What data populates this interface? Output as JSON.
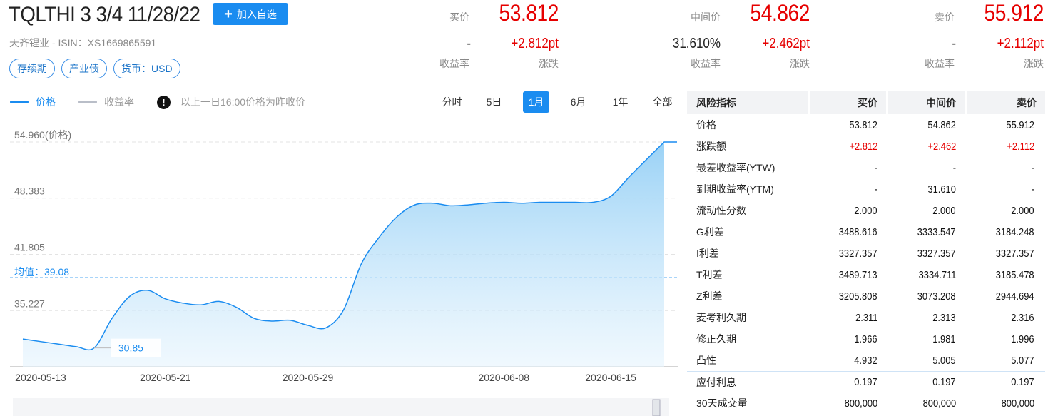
{
  "header": {
    "title": "TQLTHI 3 3/4 11/28/22",
    "watch_label": "加入自选",
    "subtitle": "天齐锂业 - ISIN：XS1669865591",
    "tags": [
      "存续期",
      "产业债",
      "货币：USD"
    ]
  },
  "quotes": {
    "bid": {
      "label": "买价",
      "price": "53.812",
      "yield": "-",
      "yield_label": "收益率",
      "change": "+2.812pt",
      "change_label": "涨跌"
    },
    "mid": {
      "label": "中间价",
      "price": "54.862",
      "yield": "31.610%",
      "yield_label": "收益率",
      "change": "+2.462pt",
      "change_label": "涨跌"
    },
    "ask": {
      "label": "卖价",
      "price": "55.912",
      "yield": "-",
      "yield_label": "收益率",
      "change": "+2.112pt",
      "change_label": "涨跌"
    }
  },
  "chart_controls": {
    "legend": [
      {
        "label": "价格",
        "color": "#1a8cf0",
        "active": true
      },
      {
        "label": "收益率",
        "color": "#b9bec8",
        "active": false
      }
    ],
    "note": "以上一日16:00价格为昨收价",
    "periods": [
      "分时",
      "5日",
      "1月",
      "6月",
      "1年",
      "全部"
    ],
    "active_period": "1月"
  },
  "chart_data": {
    "type": "area",
    "series": [
      {
        "name": "价格",
        "color": "#1a8cf0",
        "x": [
          0,
          1,
          2,
          3,
          4,
          5,
          6,
          7,
          8,
          9,
          10,
          11,
          12,
          13,
          14,
          15,
          16,
          17,
          18,
          19,
          20,
          21,
          22,
          23,
          24,
          25,
          26,
          27,
          28,
          29,
          30,
          31,
          32,
          33,
          34,
          35,
          36
        ],
        "values": [
          31.9,
          31.6,
          31.3,
          31.0,
          30.85,
          34.3,
          36.9,
          37.6,
          36.6,
          36.1,
          35.9,
          36.3,
          35.6,
          34.3,
          34.0,
          34.1,
          33.5,
          33.2,
          35.3,
          40.7,
          43.8,
          46.2,
          47.6,
          47.8,
          47.5,
          47.6,
          47.8,
          47.9,
          47.8,
          47.9,
          47.9,
          47.9,
          47.9,
          48.6,
          50.8,
          52.9,
          54.96
        ]
      }
    ],
    "x_tick_labels": [
      "2020-05-13",
      "2020-05-21",
      "2020-05-29",
      "2020-06-08",
      "2020-06-15"
    ],
    "x_tick_positions": [
      1,
      8,
      16,
      27,
      33
    ],
    "y_tick_labels": [
      "54.960(价格)",
      "48.383",
      "41.805",
      "35.227"
    ],
    "y_ticks": [
      54.96,
      48.383,
      41.805,
      35.227
    ],
    "ylim": [
      28.65,
      54.96
    ],
    "mean_label": "均值：39.08",
    "mean": 39.08,
    "min_label": "30.85",
    "min": 30.85,
    "grid": true
  },
  "risk_table": {
    "headers": [
      "风险指标",
      "买价",
      "中间价",
      "卖价"
    ],
    "rows": [
      {
        "name": "价格",
        "values": [
          "53.812",
          "54.862",
          "55.912"
        ]
      },
      {
        "name": "涨跌额",
        "values": [
          "+2.812",
          "+2.462",
          "+2.112"
        ],
        "red": true
      },
      {
        "name": "最差收益率(YTW)",
        "values": [
          "-",
          "-",
          "-"
        ]
      },
      {
        "name": "到期收益率(YTM)",
        "values": [
          "-",
          "31.610",
          "-"
        ]
      },
      {
        "name": "流动性分数",
        "values": [
          "2.000",
          "2.000",
          "2.000"
        ]
      },
      {
        "name": "G利差",
        "values": [
          "3488.616",
          "3333.547",
          "3184.248"
        ]
      },
      {
        "name": "I利差",
        "values": [
          "3327.357",
          "3327.357",
          "3327.357"
        ]
      },
      {
        "name": "T利差",
        "values": [
          "3489.713",
          "3334.711",
          "3185.478"
        ]
      },
      {
        "name": "Z利差",
        "values": [
          "3205.808",
          "3073.208",
          "2944.694"
        ]
      },
      {
        "name": "麦考利久期",
        "values": [
          "2.311",
          "2.313",
          "2.316"
        ]
      },
      {
        "name": "修正久期",
        "values": [
          "1.966",
          "1.981",
          "1.996"
        ]
      },
      {
        "name": "凸性",
        "values": [
          "4.932",
          "5.005",
          "5.077"
        ]
      },
      {
        "name": "应付利息",
        "values": [
          "0.197",
          "0.197",
          "0.197"
        ],
        "sep": true
      },
      {
        "name": "30天成交量",
        "values": [
          "800,000",
          "800,000",
          "800,000"
        ]
      }
    ]
  }
}
